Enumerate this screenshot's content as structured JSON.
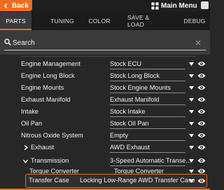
{
  "topbar": {
    "back_label": "Back",
    "main_menu_label": "Main Menu"
  },
  "tabs": [
    {
      "label": "PARTS",
      "active": true
    },
    {
      "label": "TUNING",
      "active": false
    },
    {
      "label": "COLOR",
      "active": false
    },
    {
      "label": "SAVE & LOAD",
      "active": false
    },
    {
      "label": "DEBUG",
      "active": false
    }
  ],
  "search": {
    "placeholder": "Search",
    "value": ""
  },
  "parts": [
    {
      "label": "Engine Management",
      "value": "Stock ECU"
    },
    {
      "label": "Engine Long Block",
      "value": "Stock Long Block"
    },
    {
      "label": "Engine Mounts",
      "value": "Stock Engine Mounts"
    },
    {
      "label": "Exhaust Manifold",
      "value": "Exhaust Manifold"
    },
    {
      "label": "Intake",
      "value": "Stock Intake"
    },
    {
      "label": "Oil Pan",
      "value": "Stock Oil Pan"
    },
    {
      "label": "Nitrous Oxide System",
      "value": "Empty"
    },
    {
      "label": "Exhaust",
      "value": "AWD Exhaust",
      "expander": "collapsed"
    },
    {
      "label": "Transmission",
      "value": "3-Speed Automatic Transe...",
      "expander": "expanded"
    },
    {
      "label": "Torque Converter",
      "value": "Torque Converter"
    },
    {
      "label": "Transfer Case",
      "value": "Locking Low-Range AWD Transfer Case",
      "selected": true
    }
  ],
  "colors": {
    "accent": "#f06c1f",
    "background": "#272727",
    "tabbar": "#1b1b1b",
    "search_bg": "#3b3b3b"
  }
}
